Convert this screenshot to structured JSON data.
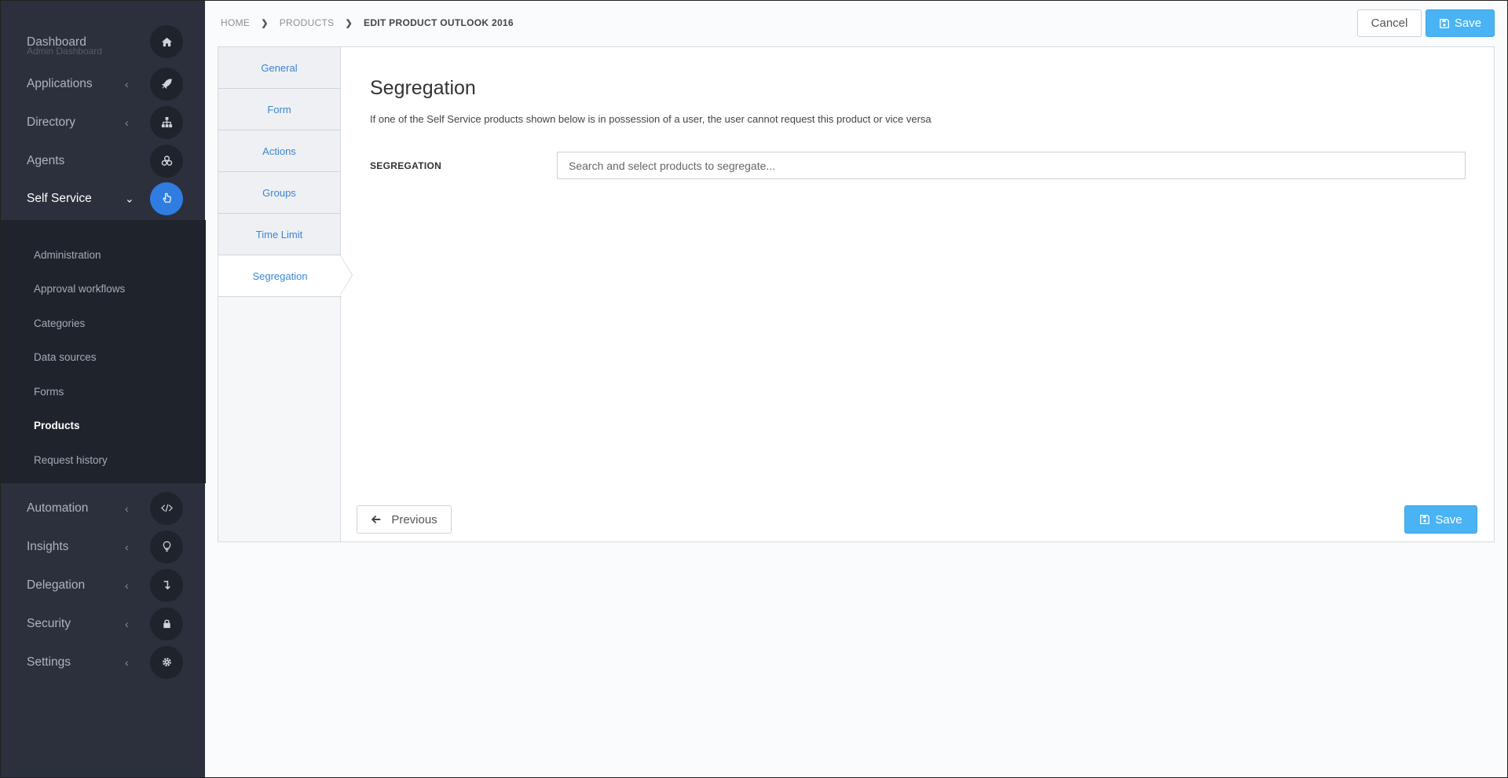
{
  "sidebar": {
    "dashboard": {
      "label": "Dashboard",
      "sub": "Admin Dashboard",
      "icon": "home-icon"
    },
    "items": [
      {
        "label": "Applications",
        "icon": "rocket-icon",
        "chevron": "<"
      },
      {
        "label": "Directory",
        "icon": "sitemap-icon",
        "chevron": "<"
      },
      {
        "label": "Agents",
        "icon": "cubes-icon"
      },
      {
        "label": "Self Service",
        "icon": "hand-pointer-icon",
        "chevron": "v",
        "active": true
      }
    ],
    "submenu": [
      {
        "label": "Administration"
      },
      {
        "label": "Approval workflows"
      },
      {
        "label": "Categories"
      },
      {
        "label": "Data sources"
      },
      {
        "label": "Forms"
      },
      {
        "label": "Products",
        "active": true
      },
      {
        "label": "Request history"
      }
    ],
    "bottom_items": [
      {
        "label": "Automation",
        "icon": "code-icon",
        "chevron": "<"
      },
      {
        "label": "Insights",
        "icon": "lightbulb-icon",
        "chevron": "<"
      },
      {
        "label": "Delegation",
        "icon": "level-down-icon",
        "chevron": "<"
      },
      {
        "label": "Security",
        "icon": "lock-icon",
        "chevron": "<"
      },
      {
        "label": "Settings",
        "icon": "gear-icon",
        "chevron": "<"
      }
    ]
  },
  "breadcrumb": {
    "home": "HOME",
    "products": "PRODUCTS",
    "current": "EDIT PRODUCT OUTLOOK 2016"
  },
  "toolbar": {
    "cancel_label": "Cancel",
    "save_label": "Save"
  },
  "tabs": [
    {
      "label": "General"
    },
    {
      "label": "Form"
    },
    {
      "label": "Actions"
    },
    {
      "label": "Groups"
    },
    {
      "label": "Time Limit"
    },
    {
      "label": "Segregation",
      "active": true
    }
  ],
  "content": {
    "title": "Segregation",
    "description": "If one of the Self Service products shown below is in possession of a user, the user cannot request this product or vice versa",
    "field_label": "SEGREGATION",
    "field_placeholder": "Search and select products to segregate..."
  },
  "footer": {
    "previous_label": "Previous",
    "save_label": "Save"
  },
  "colors": {
    "sidebar_bg": "#2b303c",
    "submenu_bg": "#1f232b",
    "accent": "#2f7de1",
    "save_btn": "#4ab3f4",
    "tab_text": "#3a86d4"
  }
}
